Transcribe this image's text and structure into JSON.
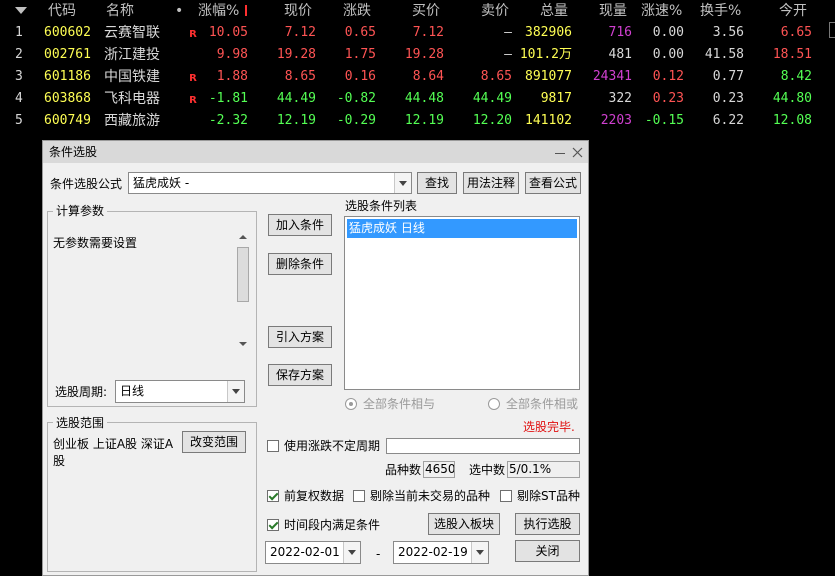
{
  "table": {
    "headers": {
      "code": "代码",
      "name": "名称",
      "dot": "•",
      "change_pct": "涨幅%",
      "price": "现价",
      "change": "涨跌",
      "bid": "买价",
      "ask": "卖价",
      "volume": "总量",
      "last_vol": "现量",
      "speed": "涨速%",
      "turnover": "换手%",
      "open": "今开"
    },
    "rows": [
      {
        "idx": "1",
        "code": "600602",
        "name": "云赛智联",
        "tag": "R",
        "change_pct": "10.05",
        "price": "7.12",
        "change": "0.65",
        "bid": "7.12",
        "ask": "–",
        "volume": "382906",
        "last_vol": "716",
        "speed": "0.00",
        "turnover": "3.56",
        "open": "6.65"
      },
      {
        "idx": "2",
        "code": "002761",
        "name": "浙江建投",
        "tag": "",
        "change_pct": "9.98",
        "price": "19.28",
        "change": "1.75",
        "bid": "19.28",
        "ask": "–",
        "volume": "101.2万",
        "last_vol": "481",
        "speed": "0.00",
        "turnover": "41.58",
        "open": "18.51"
      },
      {
        "idx": "3",
        "code": "601186",
        "name": "中国铁建",
        "tag": "R",
        "change_pct": "1.88",
        "price": "8.65",
        "change": "0.16",
        "bid": "8.64",
        "ask": "8.65",
        "volume": "891077",
        "last_vol": "24341",
        "speed": "0.12",
        "turnover": "0.77",
        "open": "8.42"
      },
      {
        "idx": "4",
        "code": "603868",
        "name": "飞科电器",
        "tag": "R",
        "change_pct": "-1.81",
        "price": "44.49",
        "change": "-0.82",
        "bid": "44.48",
        "ask": "44.49",
        "volume": "9817",
        "last_vol": "322",
        "speed": "0.23",
        "turnover": "0.23",
        "open": "44.80"
      },
      {
        "idx": "5",
        "code": "600749",
        "name": "西藏旅游",
        "tag": "",
        "change_pct": "-2.32",
        "price": "12.19",
        "change": "-0.29",
        "bid": "12.19",
        "ask": "12.20",
        "volume": "141102",
        "last_vol": "2203",
        "speed": "-0.15",
        "turnover": "6.22",
        "open": "12.08"
      }
    ]
  },
  "dialog": {
    "title": "条件选股",
    "formula_label": "条件选股公式",
    "formula_value": "猛虎成妖     -",
    "btn_find": "查找",
    "btn_usage": "用法注释",
    "btn_view": "查看公式",
    "params_group": "计算参数",
    "params_text": "无参数需要设置",
    "period_label": "选股周期:",
    "period_value": "日线",
    "btn_add": "加入条件",
    "btn_delete": "删除条件",
    "btn_import": "引入方案",
    "btn_save": "保存方案",
    "list_label": "选股条件列表",
    "list_items": [
      "猛虎成妖  日线"
    ],
    "radio_and": "全部条件相与",
    "radio_or": "全部条件相或",
    "status": "选股完毕.",
    "scope_group": "选股范围",
    "scope_text": "创业板 上证A股 深证A股",
    "btn_change_scope": "改变范围",
    "use_period_label": "使用涨跌不定周期",
    "count_label": "品种数",
    "count_value": "4650",
    "selected_label": "选中数",
    "selected_value": "5/0.1%",
    "adj_label": "前复权数据",
    "exclude_untraded_label": "剔除当前未交易的品种",
    "exclude_st_label": "剔除ST品种",
    "time_label": "时间段内满足条件",
    "btn_to_block": "选股入板块",
    "btn_execute": "执行选股",
    "date_start": "2022-02-01",
    "date_sep": "-",
    "date_end": "2022-02-19",
    "btn_close": "关闭",
    "checks": {
      "use_period": false,
      "adj": true,
      "exclude_untraded": false,
      "exclude_st": false,
      "time": true
    },
    "radio_selected": "and"
  },
  "colors": {
    "up": "#ff5454",
    "down": "#54ff54",
    "code": "#ffff54",
    "text": "#d8d8d8",
    "magenta": "#d040d0",
    "tag": "#ff3030"
  }
}
